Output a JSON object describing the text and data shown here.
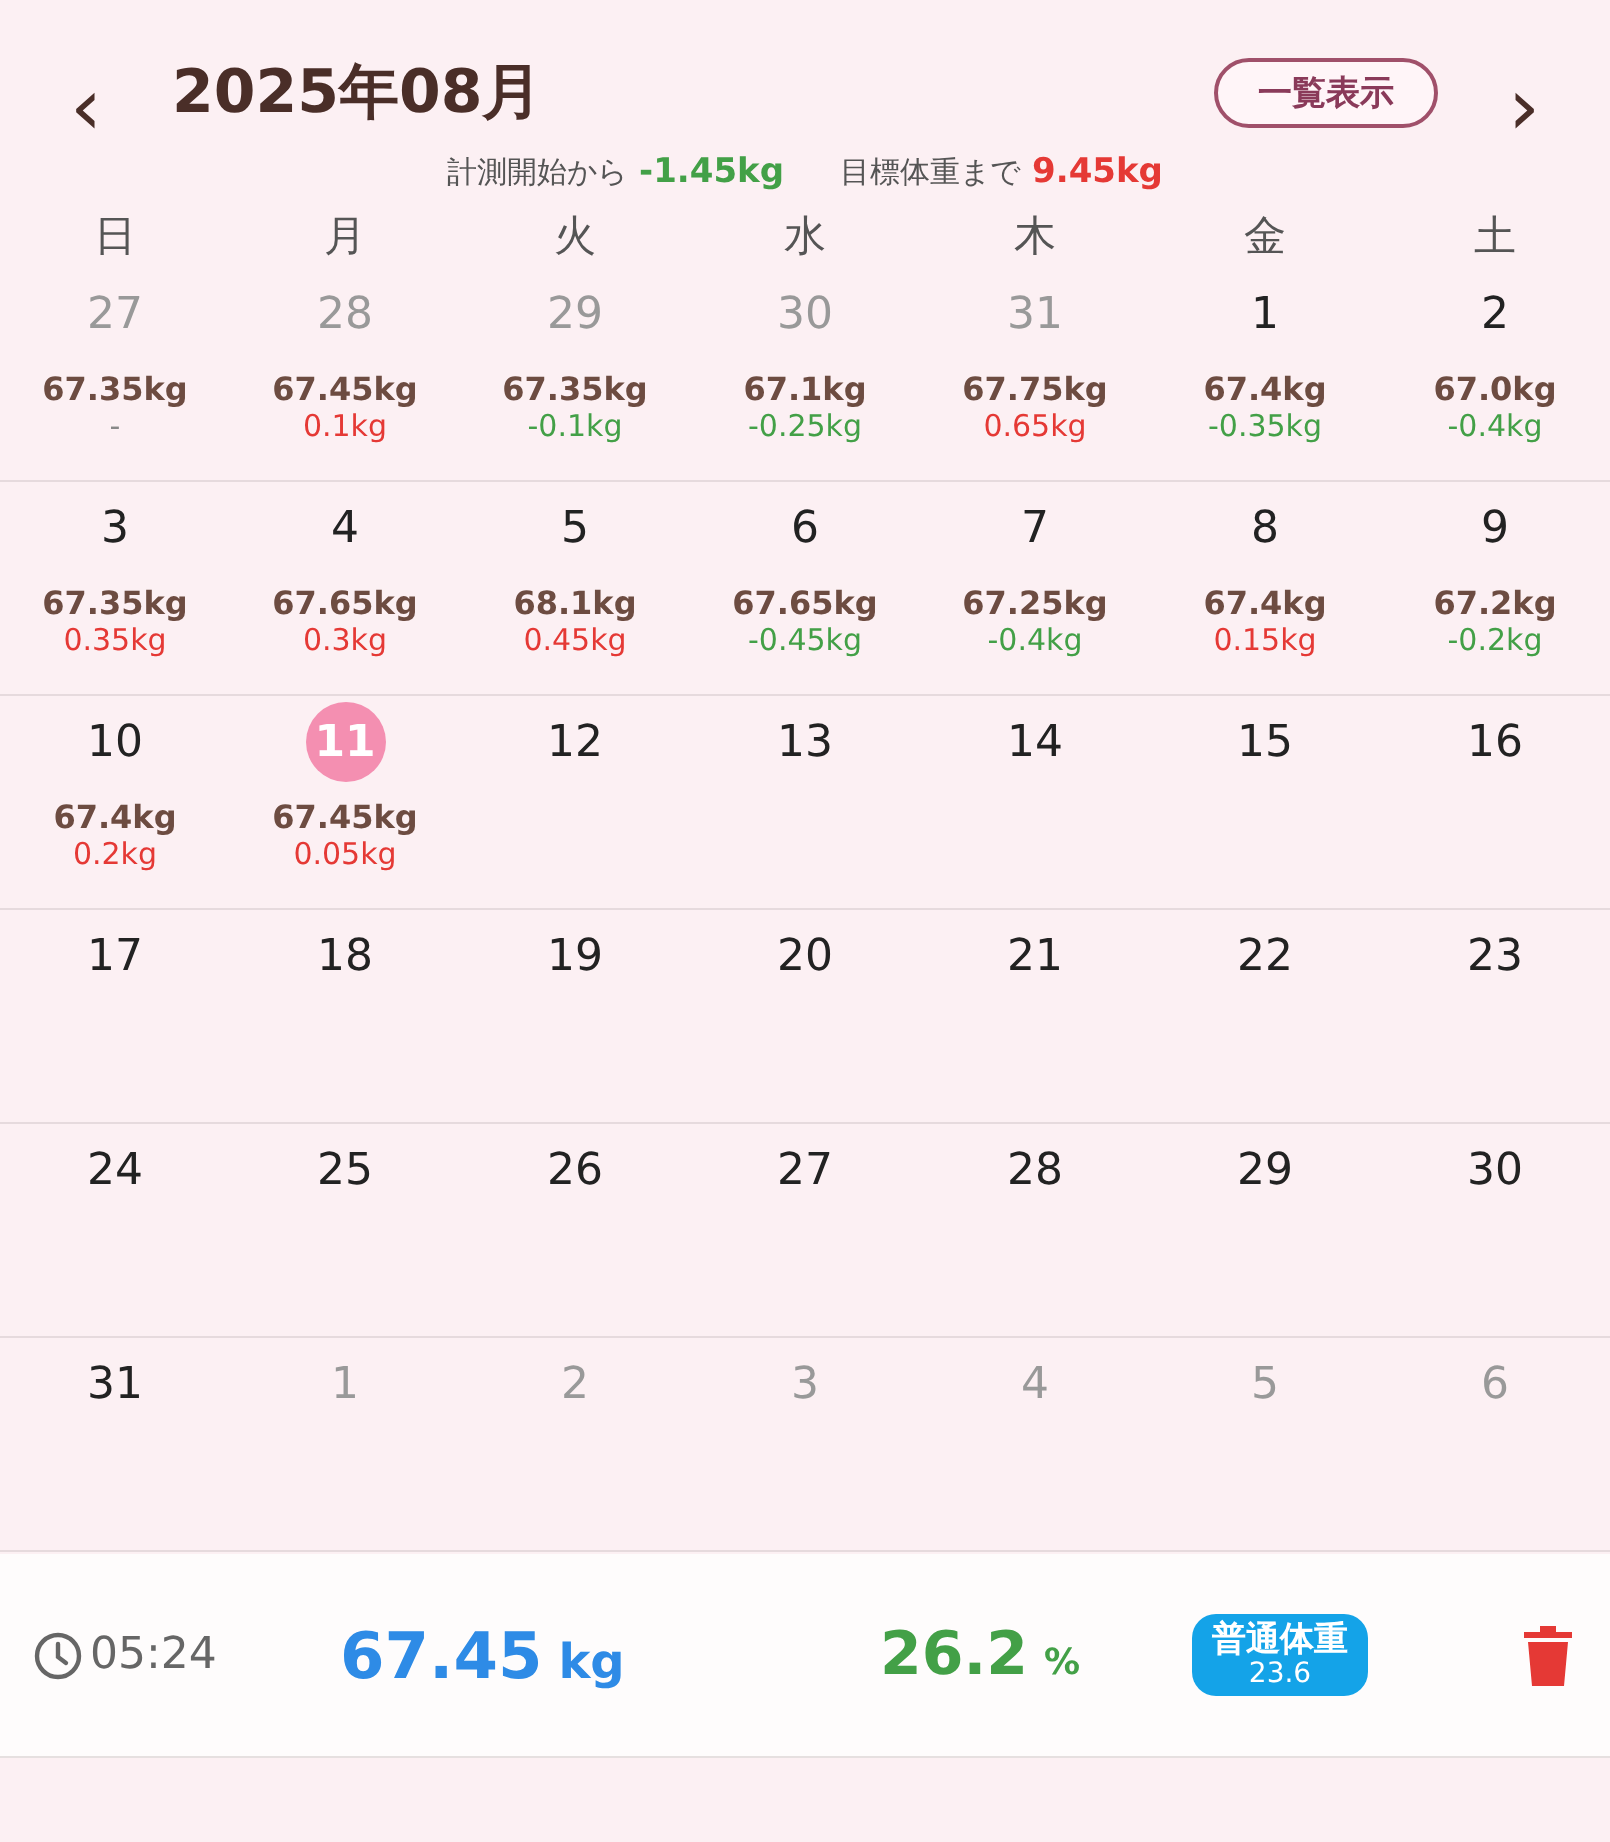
{
  "header": {
    "prev": "‹",
    "title": "2025年08月",
    "list_button": "一覧表示",
    "next": "›",
    "since_start_label": "計測開始から",
    "since_start_value": "-1.45kg",
    "to_goal_label": "目標体重まで",
    "to_goal_value": "9.45kg"
  },
  "weekdays": [
    "日",
    "月",
    "火",
    "水",
    "木",
    "金",
    "土"
  ],
  "weeks": [
    [
      {
        "date": "27",
        "in_month": false,
        "selected": false,
        "weight": "67.35kg",
        "diff": "-",
        "color": "#888888"
      },
      {
        "date": "28",
        "in_month": false,
        "selected": false,
        "weight": "67.45kg",
        "diff": "0.1kg",
        "color": "#e53935"
      },
      {
        "date": "29",
        "in_month": false,
        "selected": false,
        "weight": "67.35kg",
        "diff": "-0.1kg",
        "color": "#43a047"
      },
      {
        "date": "30",
        "in_month": false,
        "selected": false,
        "weight": "67.1kg",
        "diff": "-0.25kg",
        "color": "#43a047"
      },
      {
        "date": "31",
        "in_month": false,
        "selected": false,
        "weight": "67.75kg",
        "diff": "0.65kg",
        "color": "#e53935"
      },
      {
        "date": "1",
        "in_month": true,
        "selected": false,
        "weight": "67.4kg",
        "diff": "-0.35kg",
        "color": "#43a047"
      },
      {
        "date": "2",
        "in_month": true,
        "selected": false,
        "weight": "67.0kg",
        "diff": "-0.4kg",
        "color": "#43a047"
      }
    ],
    [
      {
        "date": "3",
        "in_month": true,
        "selected": false,
        "weight": "67.35kg",
        "diff": "0.35kg",
        "color": "#e53935"
      },
      {
        "date": "4",
        "in_month": true,
        "selected": false,
        "weight": "67.65kg",
        "diff": "0.3kg",
        "color": "#e53935"
      },
      {
        "date": "5",
        "in_month": true,
        "selected": false,
        "weight": "68.1kg",
        "diff": "0.45kg",
        "color": "#e53935"
      },
      {
        "date": "6",
        "in_month": true,
        "selected": false,
        "weight": "67.65kg",
        "diff": "-0.45kg",
        "color": "#43a047"
      },
      {
        "date": "7",
        "in_month": true,
        "selected": false,
        "weight": "67.25kg",
        "diff": "-0.4kg",
        "color": "#43a047"
      },
      {
        "date": "8",
        "in_month": true,
        "selected": false,
        "weight": "67.4kg",
        "diff": "0.15kg",
        "color": "#e53935"
      },
      {
        "date": "9",
        "in_month": true,
        "selected": false,
        "weight": "67.2kg",
        "diff": "-0.2kg",
        "color": "#43a047"
      }
    ],
    [
      {
        "date": "10",
        "in_month": true,
        "selected": false,
        "weight": "67.4kg",
        "diff": "0.2kg",
        "color": "#e53935"
      },
      {
        "date": "11",
        "in_month": true,
        "selected": true,
        "weight": "67.45kg",
        "diff": "0.05kg",
        "color": "#e53935"
      },
      {
        "date": "12",
        "in_month": true,
        "selected": false
      },
      {
        "date": "13",
        "in_month": true,
        "selected": false
      },
      {
        "date": "14",
        "in_month": true,
        "selected": false
      },
      {
        "date": "15",
        "in_month": true,
        "selected": false
      },
      {
        "date": "16",
        "in_month": true,
        "selected": false
      }
    ],
    [
      {
        "date": "17",
        "in_month": true,
        "selected": false
      },
      {
        "date": "18",
        "in_month": true,
        "selected": false
      },
      {
        "date": "19",
        "in_month": true,
        "selected": false
      },
      {
        "date": "20",
        "in_month": true,
        "selected": false
      },
      {
        "date": "21",
        "in_month": true,
        "selected": false
      },
      {
        "date": "22",
        "in_month": true,
        "selected": false
      },
      {
        "date": "23",
        "in_month": true,
        "selected": false
      }
    ],
    [
      {
        "date": "24",
        "in_month": true,
        "selected": false
      },
      {
        "date": "25",
        "in_month": true,
        "selected": false
      },
      {
        "date": "26",
        "in_month": true,
        "selected": false
      },
      {
        "date": "27",
        "in_month": true,
        "selected": false
      },
      {
        "date": "28",
        "in_month": true,
        "selected": false
      },
      {
        "date": "29",
        "in_month": true,
        "selected": false
      },
      {
        "date": "30",
        "in_month": true,
        "selected": false
      }
    ],
    [
      {
        "date": "31",
        "in_month": true,
        "selected": false
      },
      {
        "date": "1",
        "in_month": false,
        "selected": false
      },
      {
        "date": "2",
        "in_month": false,
        "selected": false
      },
      {
        "date": "3",
        "in_month": false,
        "selected": false
      },
      {
        "date": "4",
        "in_month": false,
        "selected": false
      },
      {
        "date": "5",
        "in_month": false,
        "selected": false
      },
      {
        "date": "6",
        "in_month": false,
        "selected": false
      }
    ]
  ],
  "entry": {
    "time": "05:24",
    "weight": "67.45",
    "weight_unit": "kg",
    "body_fat": "26.2",
    "body_fat_unit": "%",
    "bmi_label": "普通体重",
    "bmi": "23.6"
  }
}
